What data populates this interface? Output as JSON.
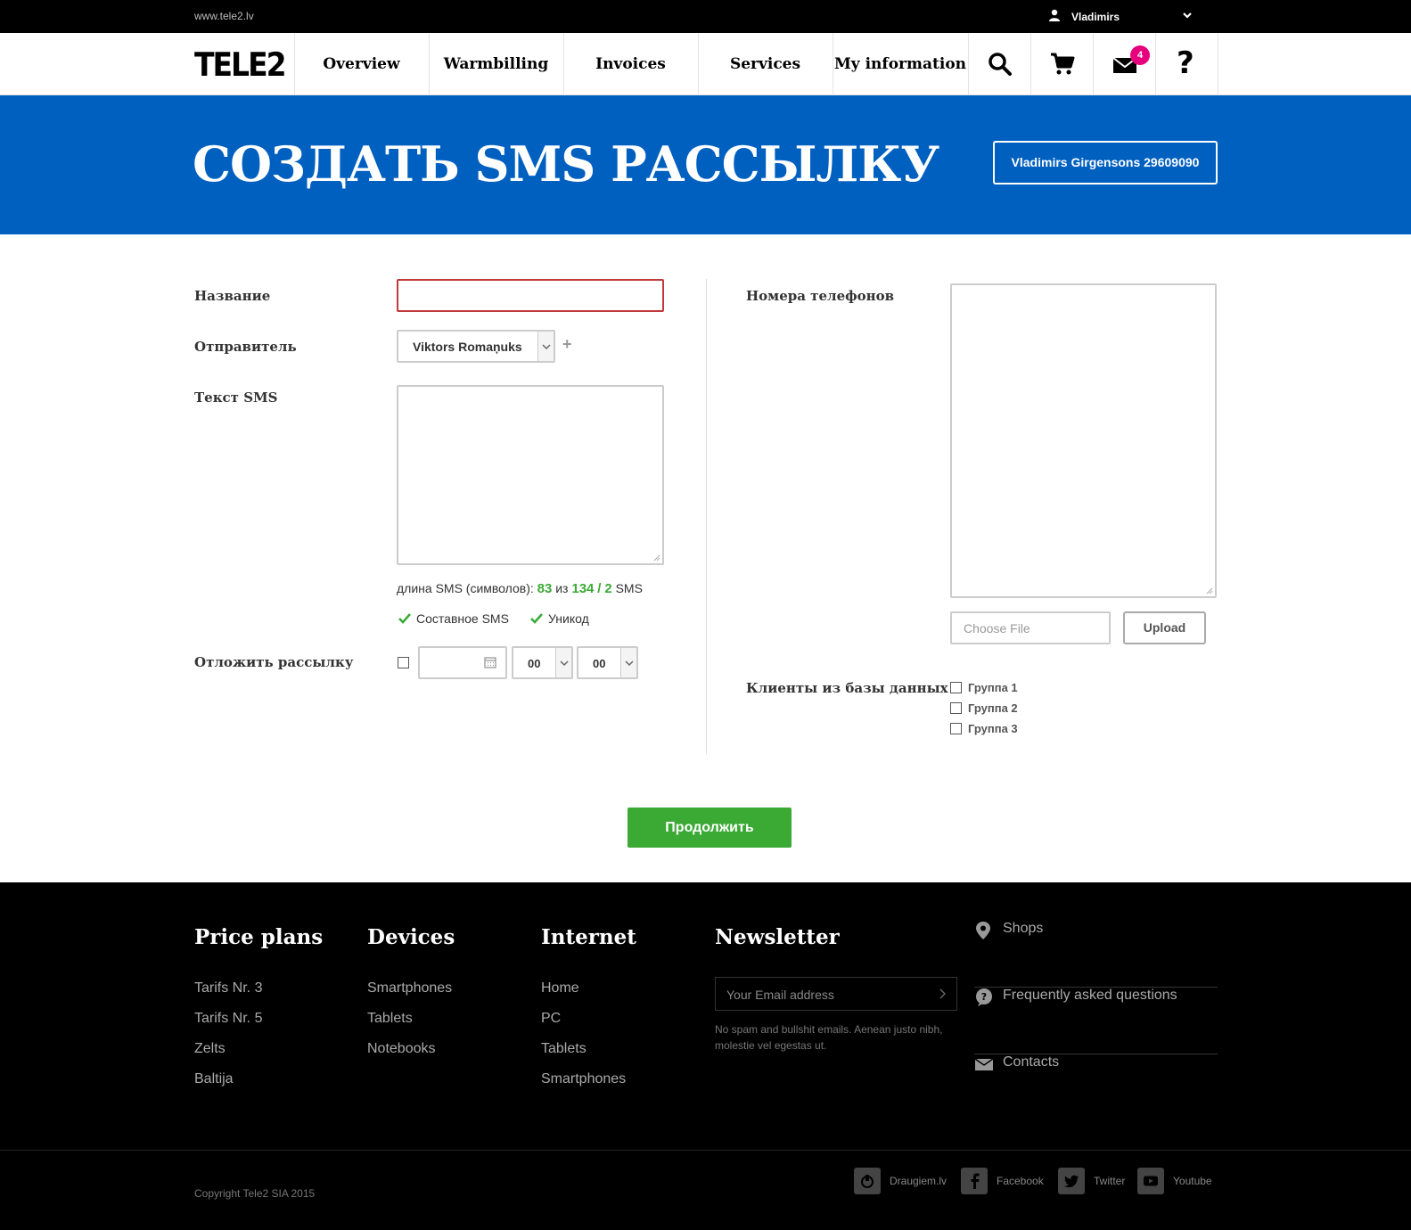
{
  "topbar": {
    "site_url": "www.tele2.lv",
    "user_name": "Vladimirs"
  },
  "nav": {
    "logo": "TELE2",
    "items": [
      {
        "label": "Overview"
      },
      {
        "label": "Warmbilling"
      },
      {
        "label": "Invoices"
      },
      {
        "label": "Services"
      },
      {
        "label": "My information"
      }
    ],
    "icons": [
      "search-icon",
      "cart-icon",
      "mail-icon",
      "help-icon"
    ],
    "mail_badge": "4",
    "help_glyph": "?"
  },
  "hero": {
    "title": "СОЗДАТЬ SMS РАССЫЛКУ",
    "account": "Vladimirs Girgensons 29609090"
  },
  "form": {
    "name_label": "Название",
    "name_value": "",
    "sender_label": "Отправитель",
    "sender_value": "Viktors Romaņuks",
    "add_sender": "+",
    "sms_text_label": "Текст SMS",
    "sms_text_value": "",
    "length_prefix": "длина SMS (символов):",
    "length_current": "83",
    "length_of": "из",
    "length_max": "134",
    "length_sep": "/",
    "length_count": "2",
    "length_suffix": "SMS",
    "option_compound": "Составное SMS",
    "option_unicode": "Уникод",
    "delay_label": "Отложить рассылку",
    "date_value": "",
    "hour_value": "00",
    "minute_value": "00",
    "phones_label": "Номера телефонов",
    "phones_value": "",
    "choose_file": "Choose File",
    "upload": "Upload",
    "db_clients_label": "Клиенты из базы данных",
    "groups": [
      "Группа 1",
      "Группа 2",
      "Группа 3"
    ],
    "continue": "Продолжить"
  },
  "footer": {
    "columns": [
      {
        "title": "Price plans",
        "links": [
          "Tarifs Nr. 3",
          "Tarifs Nr. 5",
          "Zelts",
          "Baltija"
        ]
      },
      {
        "title": "Devices",
        "links": [
          "Smartphones",
          "Tablets",
          "Notebooks"
        ]
      },
      {
        "title": "Internet",
        "links": [
          "Home",
          "PC",
          "Tablets",
          "Smartphones"
        ]
      }
    ],
    "newsletter": {
      "title": "Newsletter",
      "placeholder": "Your Email address",
      "note": "No spam and bullshit emails. Aenean justo nibh, molestie vel egestas ut."
    },
    "side_links": [
      "Shops",
      "Frequently asked questions",
      "Contacts"
    ],
    "copyright": "Copyright Tele2 SIA 2015",
    "social": [
      "Draugiem.lv",
      "Facebook",
      "Twitter",
      "Youtube"
    ]
  },
  "colors": {
    "hero_blue": "#0060c0",
    "accent_green": "#3aaa35",
    "badge_pink": "#e6007e",
    "error_red": "#c0393b"
  }
}
